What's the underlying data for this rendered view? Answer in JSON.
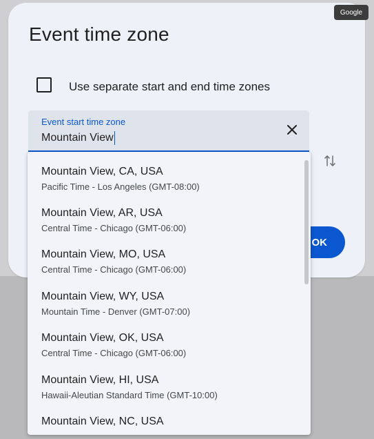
{
  "dialog": {
    "title": "Event time zone",
    "separate_zones_label": "Use separate start and end time zones",
    "ok_label": "OK"
  },
  "start_field": {
    "label": "Event start time zone",
    "value": "Mountain View"
  },
  "badge": "Google",
  "accent_color": "#0b57d0",
  "options": [
    {
      "title": "Mountain View, CA, USA",
      "subtitle": "Pacific Time - Los Angeles (GMT-08:00)"
    },
    {
      "title": "Mountain View, AR, USA",
      "subtitle": "Central Time - Chicago (GMT-06:00)"
    },
    {
      "title": "Mountain View, MO, USA",
      "subtitle": "Central Time - Chicago (GMT-06:00)"
    },
    {
      "title": "Mountain View, WY, USA",
      "subtitle": "Mountain Time - Denver (GMT-07:00)"
    },
    {
      "title": "Mountain View, OK, USA",
      "subtitle": "Central Time - Chicago (GMT-06:00)"
    },
    {
      "title": "Mountain View, HI, USA",
      "subtitle": "Hawaii-Aleutian Standard Time (GMT-10:00)"
    },
    {
      "title": "Mountain View, NC, USA",
      "subtitle": ""
    }
  ]
}
